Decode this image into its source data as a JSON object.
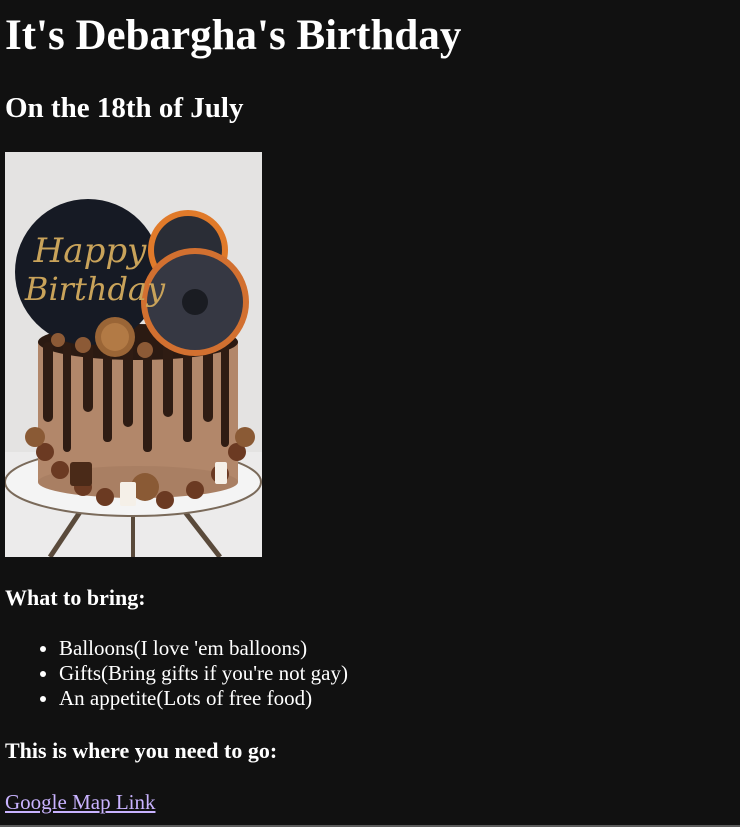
{
  "page": {
    "title": "It's Debargha's Birthday",
    "subtitle": "On the 18th of July"
  },
  "image": {
    "text_lines": [
      "Happy",
      "Birthday"
    ]
  },
  "bring": {
    "heading": "What to bring:",
    "items": [
      "Balloons(I love 'em balloons)",
      "Gifts(Bring gifts if you're not gay)",
      "An appetite(Lots of free food)"
    ]
  },
  "location": {
    "heading": "This is where you need to go:",
    "link_text": "Google Map Link"
  },
  "colors": {
    "background": "#111111",
    "text": "#ffffff",
    "link": "#c9b3ff"
  }
}
